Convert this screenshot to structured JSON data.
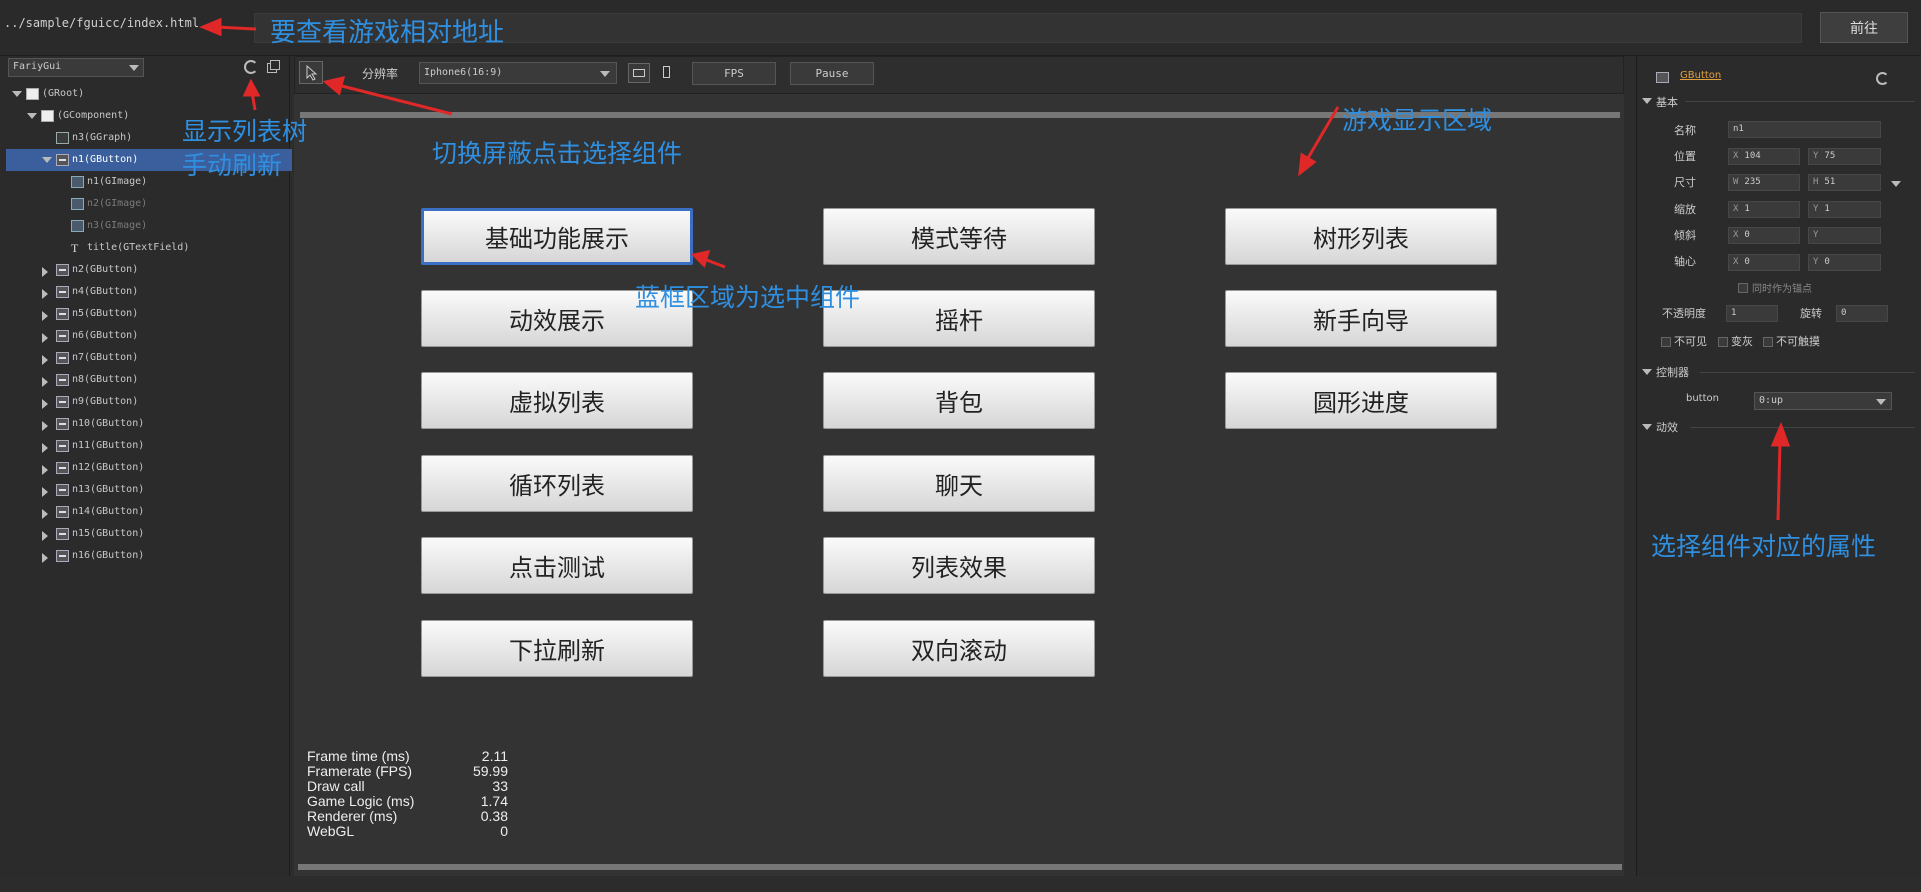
{
  "topbar": {
    "url": "../sample/fguicc/index.html",
    "go_label": "前往"
  },
  "left_panel": {
    "selector_value": "FariyGui",
    "tree": [
      {
        "label": "(GRoot)",
        "depth": 0,
        "expand": "down",
        "icon": "doc"
      },
      {
        "label": "(GComponent)",
        "depth": 1,
        "expand": "down",
        "icon": "doc"
      },
      {
        "label": "n3(GGraph)",
        "depth": 2,
        "expand": "",
        "icon": "graph"
      },
      {
        "label": "n1(GButton)",
        "depth": 2,
        "expand": "down",
        "icon": "btn",
        "selected": true
      },
      {
        "label": "n1(GImage)",
        "depth": 3,
        "expand": "",
        "icon": "img"
      },
      {
        "label": "n2(GImage)",
        "depth": 3,
        "expand": "",
        "icon": "img",
        "dim": true
      },
      {
        "label": "n3(GImage)",
        "depth": 3,
        "expand": "",
        "icon": "img",
        "dim": true
      },
      {
        "label": "title(GTextField)",
        "depth": 3,
        "expand": "",
        "icon": "txt"
      },
      {
        "label": "n2(GButton)",
        "depth": 2,
        "expand": "right",
        "icon": "btn"
      },
      {
        "label": "n4(GButton)",
        "depth": 2,
        "expand": "right",
        "icon": "btn"
      },
      {
        "label": "n5(GButton)",
        "depth": 2,
        "expand": "right",
        "icon": "btn"
      },
      {
        "label": "n6(GButton)",
        "depth": 2,
        "expand": "right",
        "icon": "btn"
      },
      {
        "label": "n7(GButton)",
        "depth": 2,
        "expand": "right",
        "icon": "btn"
      },
      {
        "label": "n8(GButton)",
        "depth": 2,
        "expand": "right",
        "icon": "btn"
      },
      {
        "label": "n9(GButton)",
        "depth": 2,
        "expand": "right",
        "icon": "btn"
      },
      {
        "label": "n10(GButton)",
        "depth": 2,
        "expand": "right",
        "icon": "btn"
      },
      {
        "label": "n11(GButton)",
        "depth": 2,
        "expand": "right",
        "icon": "btn"
      },
      {
        "label": "n12(GButton)",
        "depth": 2,
        "expand": "right",
        "icon": "btn"
      },
      {
        "label": "n13(GButton)",
        "depth": 2,
        "expand": "right",
        "icon": "btn"
      },
      {
        "label": "n14(GButton)",
        "depth": 2,
        "expand": "right",
        "icon": "btn"
      },
      {
        "label": "n15(GButton)",
        "depth": 2,
        "expand": "right",
        "icon": "btn"
      },
      {
        "label": "n16(GButton)",
        "depth": 2,
        "expand": "right",
        "icon": "btn"
      }
    ]
  },
  "toolbar": {
    "resolution_label": "分辨率",
    "resolution_value": "Iphone6(16:9)",
    "fps_label": "FPS",
    "pause_label": "Pause"
  },
  "stage": {
    "buttons": [
      "基础功能展示",
      "模式等待",
      "树形列表",
      "动效展示",
      "摇杆",
      "新手向导",
      "虚拟列表",
      "背包",
      "圆形进度",
      "循环列表",
      "聊天",
      "点击测试",
      "列表效果",
      "下拉刷新",
      "双向滚动"
    ],
    "selected_button": "基础功能展示",
    "stats": {
      "labels": [
        "Frame time (ms)",
        "Framerate (FPS)",
        "Draw call",
        "Game Logic (ms)",
        "Renderer (ms)",
        "WebGL"
      ],
      "values": [
        "2.11",
        "59.99",
        "33",
        "1.74",
        "0.38",
        "0"
      ]
    }
  },
  "right_panel": {
    "component_type": "GButton",
    "basic_section": "基本",
    "name_label": "名称",
    "name_value": "n1",
    "position_label": "位置",
    "pos_x": "104",
    "pos_y": "75",
    "size_label": "尺寸",
    "size_w": "235",
    "size_h": "51",
    "scale_label": "缩放",
    "scale_x": "1",
    "scale_y": "1",
    "skew_label": "倾斜",
    "skew_x": "0",
    "skew_y": "",
    "pivot_label": "轴心",
    "pivot_x": "0",
    "pivot_y": "0",
    "anchor_label": "同时作为锚点",
    "alpha_label": "不透明度",
    "alpha_value": "1",
    "rotation_label": "旋转",
    "rotation_value": "0",
    "invisible_label": "不可见",
    "gray_label": "变灰",
    "untouchable_label": "不可触摸",
    "controller_section": "控制器",
    "controller_name": "button",
    "controller_value": "0:up",
    "transition_section": "动效",
    "x_letter": "X",
    "y_letter": "Y",
    "w_letter": "W",
    "h_letter": "H"
  },
  "annotations": {
    "url_note": "要查看游戏相对地址",
    "tree_note_1": "显示列表树",
    "tree_note_2": "手动刷新",
    "toggle_note": "切换屏蔽点击选择组件",
    "game_area_note": "游戏显示区域",
    "selected_note": "蓝框区域为选中组件",
    "props_note": "选择组件对应的属性"
  },
  "colors": {
    "annotation": "#2f8fe0",
    "arrow": "#e02828",
    "selection": "#3a6fc4",
    "tree_selected": "#3a5f9c"
  }
}
